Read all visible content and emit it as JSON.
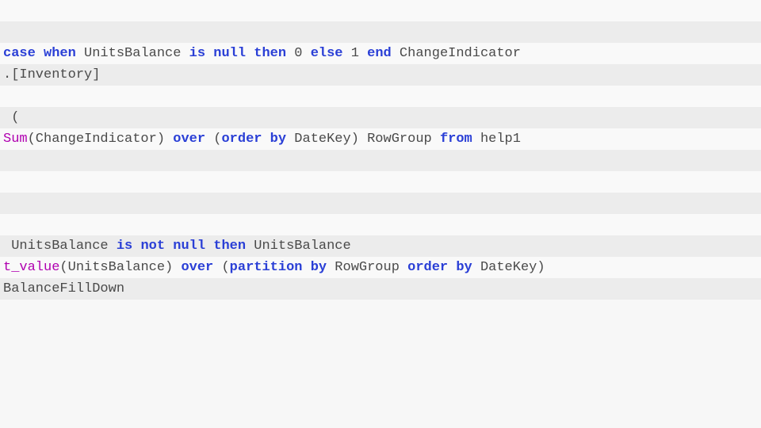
{
  "code": {
    "line1": "",
    "line2": "",
    "line3_kw1": "case when",
    "line3_t1": " UnitsBalance ",
    "line3_kw2": "is null",
    "line3_t2": " ",
    "line3_kw3": "then",
    "line3_t3": " 0 ",
    "line3_kw4": "else",
    "line3_t4": " 1 ",
    "line3_kw5": "end",
    "line3_t5": " ChangeIndicator",
    "line4": ".[Inventory]",
    "line5": "",
    "line6": " (",
    "line7_fn": "Sum",
    "line7_t1": "(ChangeIndicator) ",
    "line7_kw1": "over",
    "line7_t2": " (",
    "line7_kw2": "order by",
    "line7_t3": " DateKey) RowGroup ",
    "line7_kw3": "from",
    "line7_t4": " help1",
    "line8": "",
    "line9": "",
    "line10": "",
    "line11": "",
    "line12_t1": " UnitsBalance ",
    "line12_kw1": "is",
    "line12_t2": " ",
    "line12_kw2": "not null",
    "line12_t3": " ",
    "line12_kw3": "then",
    "line12_t4": " UnitsBalance",
    "line13_fn": "t_value",
    "line13_t1": "(UnitsBalance) ",
    "line13_kw1": "over",
    "line13_t2": " (",
    "line13_kw2": "partition by",
    "line13_t3": " RowGroup ",
    "line13_kw3": "order by",
    "line13_t4": " DateKey)",
    "line14": "BalanceFillDown"
  }
}
